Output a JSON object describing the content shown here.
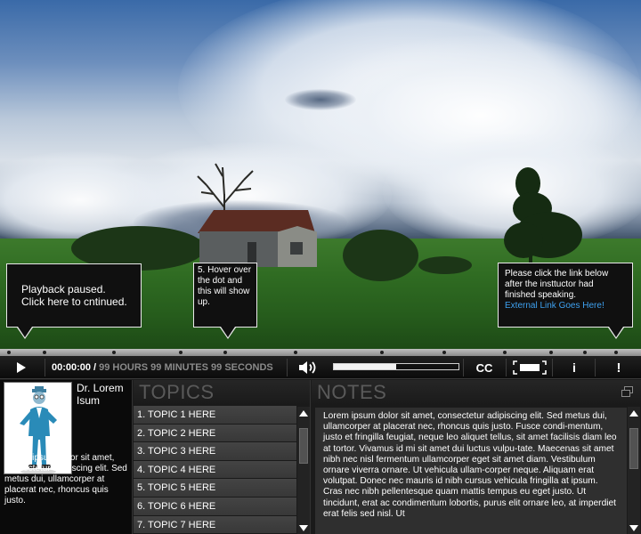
{
  "callouts": {
    "paused": "Playback paused.\nClick here to cntinued.",
    "hover": "5. Hover over the dot and this will show up.",
    "link_message": "Please click the link below after the insttuctor had finished speaking.",
    "link_text": "External Link Goes Here!"
  },
  "player": {
    "play_icon": "play-icon",
    "current_time": "00:00:00",
    "separator": "/",
    "duration": "99 HOURS 99 MINUTES 99 SECONDS",
    "volume_icon": "speaker-icon",
    "progress": 0.5,
    "cc_label": "CC",
    "fullscreen_icon": "fullscreen-icon",
    "info_label": "i",
    "alert_label": "!"
  },
  "instructor": {
    "name": "Dr. Lorem Isum",
    "bio": "Lorem ipsum dolor sit amet, consectetur adipiscing elit. Sed metus dui, ullamcorper at placerat nec, rhoncus quis justo."
  },
  "topics": {
    "heading": "TOPICS",
    "items": [
      "1. TOPIC 1 HERE",
      "2. TOPIC 2 HERE",
      "3. TOPIC 3 HERE",
      "4. TOPIC 4 HERE",
      "5. TOPIC 5 HERE",
      "6. TOPIC 6 HERE",
      "7. TOPIC 7 HERE"
    ]
  },
  "notes": {
    "heading": "NOTES",
    "body": "Lorem ipsum dolor sit amet, consectetur adipiscing elit. Sed metus dui, ullamcorper at placerat nec, rhoncus quis justo. Fusce condi-mentum, justo et fringilla feugiat, neque leo aliquet tellus, sit amet facilisis diam leo at tortor. Vivamus id mi sit amet dui luctus vulpu-tate. Maecenas sit amet nibh nec nisl fermentum ullamcorper eget sit amet diam. Vestibulum ornare viverra ornare. Ut vehicula ullam-corper neque. Aliquam erat volutpat. Donec nec mauris id nibh cursus vehicula fringilla at ipsum. Cras nec nibh pellentesque quam mattis tempus eu eget justo. Ut tincidunt, erat ac condimentum lobortis, purus elit ornare leo, at imperdiet erat felis sed nisl. Ut"
  },
  "colors": {
    "link": "#3ea1f0",
    "panel_bg": "#1a1a1a",
    "topic_bg": "#3e3e3e"
  }
}
